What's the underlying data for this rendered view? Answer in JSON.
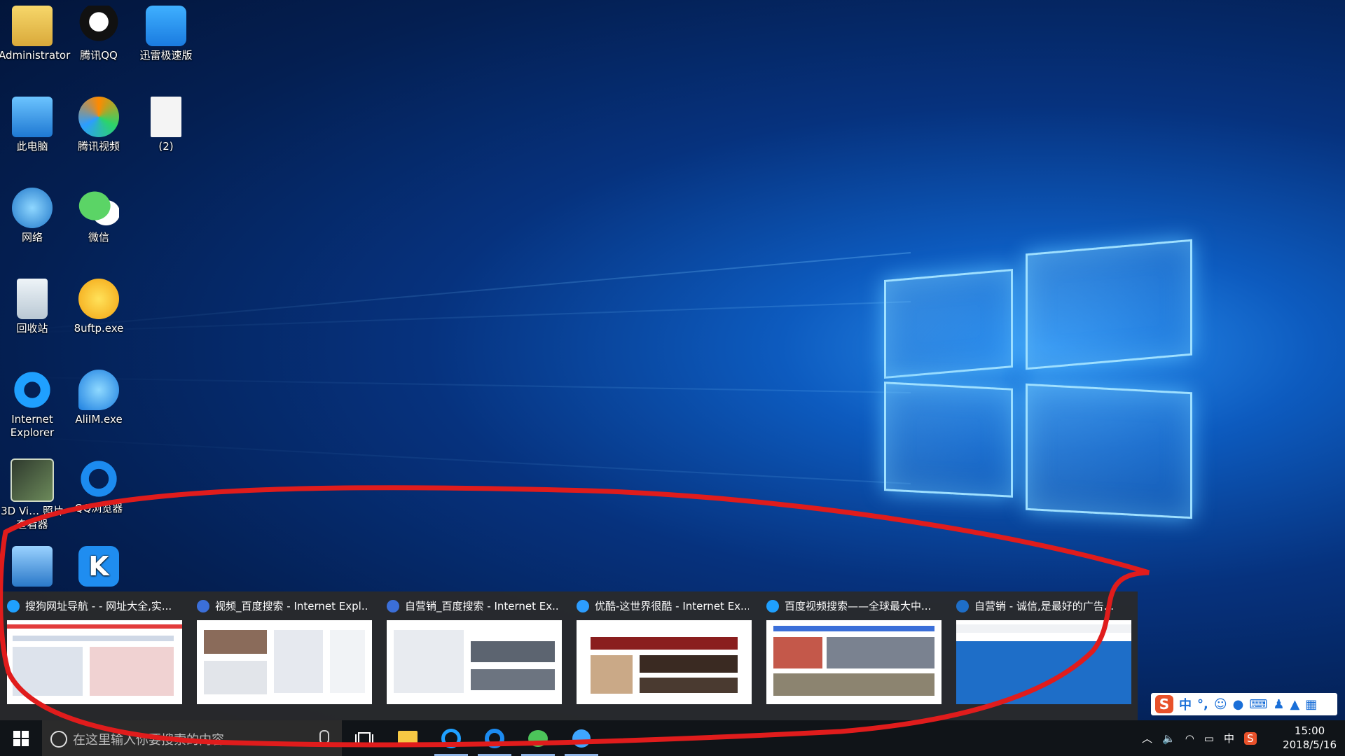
{
  "desktop": {
    "icons": [
      {
        "label": "Administrator",
        "icon": "folder-user-icon"
      },
      {
        "label": "腾讯QQ",
        "icon": "qq-penguin-icon"
      },
      {
        "label": "迅雷极速版",
        "icon": "thunder-bird-icon"
      },
      {
        "label": "此电脑",
        "icon": "computer-icon"
      },
      {
        "label": "腾讯视频",
        "icon": "tencent-video-icon"
      },
      {
        "label": "(2)",
        "icon": "blank-file-icon"
      },
      {
        "label": "网络",
        "icon": "network-globe-icon"
      },
      {
        "label": "微信",
        "icon": "wechat-icon"
      },
      {
        "label": "回收站",
        "icon": "recycle-bin-icon"
      },
      {
        "label": "8uftp.exe",
        "icon": "ftp-smiley-icon"
      },
      {
        "label": "Internet Explorer",
        "icon": "ie-icon"
      },
      {
        "label": "AliIM.exe",
        "icon": "aliim-icon"
      },
      {
        "label": "3D Vi… 照片查看器",
        "icon": "photo-viewer-icon"
      },
      {
        "label": "QQ浏览器",
        "icon": "qq-browser-icon"
      },
      {
        "label": "",
        "icon": "network-computers-icon"
      },
      {
        "label": "",
        "icon": "kugou-icon"
      }
    ]
  },
  "thumbnails": [
    {
      "title": "搜狗网址导航 - - 网址大全,实...",
      "icon": "ie-icon",
      "accent": "#e23b3b"
    },
    {
      "title": "视频_百度搜索 - Internet Expl...",
      "icon": "baidu-paw-icon",
      "accent": "#3b6fd9"
    },
    {
      "title": "自营销_百度搜索 - Internet Ex...",
      "icon": "baidu-paw-icon",
      "accent": "#3b6fd9"
    },
    {
      "title": "优酷-这世界很酷 - Internet Ex...",
      "icon": "youku-icon",
      "accent": "#c23a2a"
    },
    {
      "title": "百度视频搜索——全球最大中...",
      "icon": "ie-icon",
      "accent": "#3b6fd9"
    },
    {
      "title": "自营销 - 诚信,是最好的广告...",
      "icon": "browser-icon",
      "accent": "#1e6ec8"
    }
  ],
  "taskbar": {
    "search_placeholder": "在这里输入你要搜索的内容",
    "apps": [
      "task-view-icon",
      "file-explorer-icon",
      "ie-icon",
      "qq-browser-icon",
      "wechat-icon",
      "thunder-icon"
    ]
  },
  "tray": {
    "ime_indicator": "中",
    "time": "15:00",
    "date": "2018/5/16"
  },
  "ime_toolbar": {
    "logo": "S",
    "mode": "中",
    "punct": "°,"
  },
  "colors": {
    "annotation": "#e01c1c",
    "taskbar": "#101418",
    "thumb_strip": "#2a2a2a"
  }
}
